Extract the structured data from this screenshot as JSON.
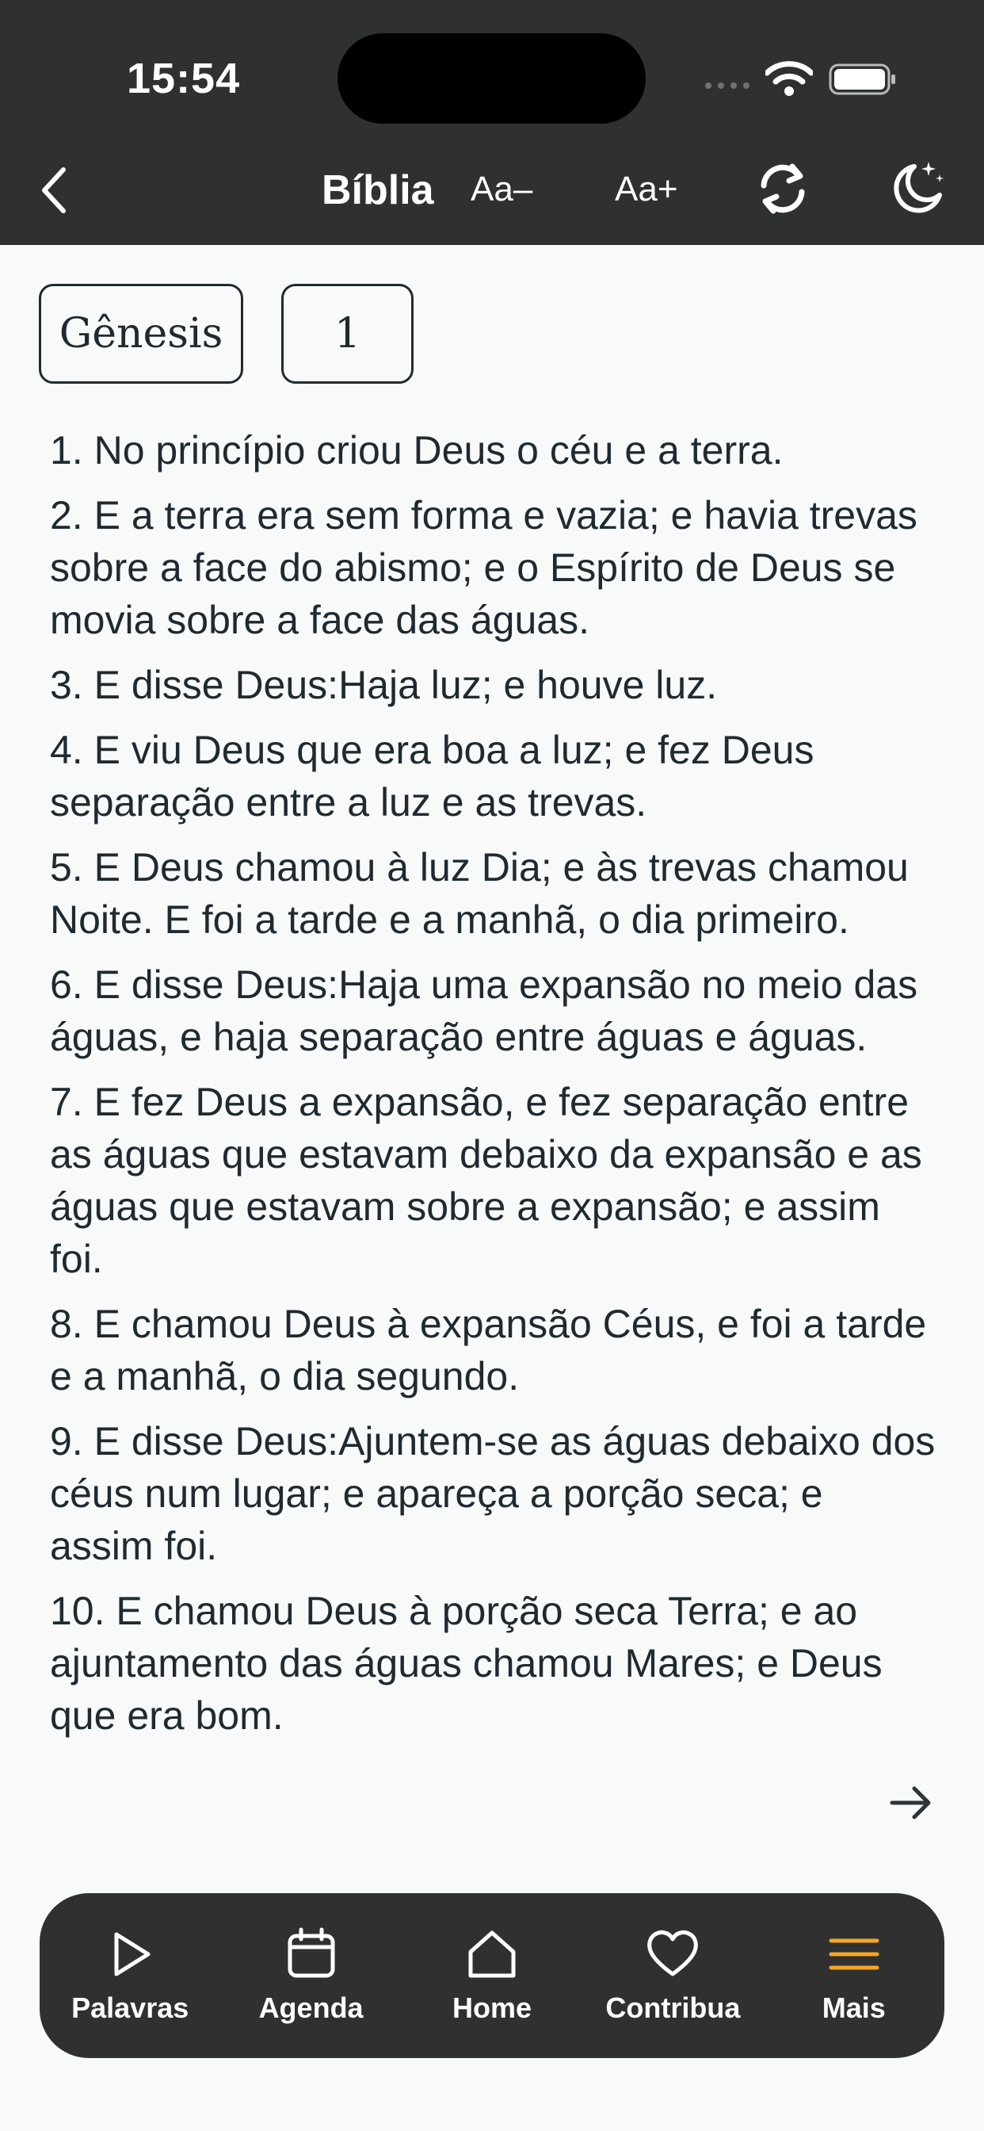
{
  "status": {
    "time": "15:54"
  },
  "header": {
    "title": "Bíblia",
    "font_decrease": "Aa–",
    "font_increase": "Aa+",
    "icons": [
      "chevron-left-icon",
      "sync-icon",
      "moon-stars-icon"
    ]
  },
  "selectors": {
    "book": "Gênesis",
    "chapter": "1"
  },
  "verses": [
    "1. No princípio criou Deus o céu e a terra.",
    "2. E a terra era sem forma e vazia; e havia trevas sobre a face do abismo; e o Espírito de Deus se movia sobre a face das águas.",
    "3. E disse Deus:Haja luz; e houve luz.",
    "4. E viu Deus que era boa a luz; e fez Deus separação entre a luz e as trevas.",
    "5. E Deus chamou à luz Dia; e às trevas chamou Noite. E foi a tarde e a manhã, o dia primeiro.",
    "6. E disse Deus:Haja uma expansão no meio das águas, e haja separação entre águas e águas.",
    "7. E fez Deus a expansão, e fez separação entre as águas que estavam debaixo da expansão e as águas que estavam sobre a expansão; e assim foi.",
    "8. E chamou Deus à expansão Céus, e foi a tarde e a manhã, o dia segundo.",
    "9. E disse Deus:Ajuntem-se as águas debaixo dos céus num lugar; e apareça a porção seca; e assim foi.",
    "10. E chamou Deus à porção seca Terra; e ao ajuntamento das águas chamou Mares; e Deus que era bom."
  ],
  "tabbar": {
    "items": [
      {
        "label": "Palavras",
        "icon": "play-icon"
      },
      {
        "label": "Agenda",
        "icon": "calendar-icon"
      },
      {
        "label": "Home",
        "icon": "home-icon"
      },
      {
        "label": "Contribua",
        "icon": "heart-icon"
      },
      {
        "label": "Mais",
        "icon": "menu-icon"
      }
    ],
    "active_color": "#f5a623"
  }
}
